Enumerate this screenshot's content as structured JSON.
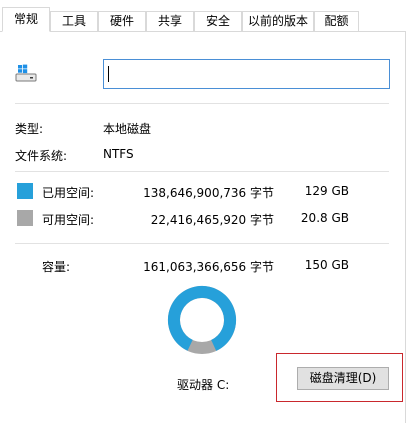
{
  "tabs": [
    {
      "label": "常规",
      "active": true
    },
    {
      "label": "工具"
    },
    {
      "label": "硬件"
    },
    {
      "label": "共享"
    },
    {
      "label": "安全"
    },
    {
      "label": "以前的版本"
    },
    {
      "label": "配额"
    }
  ],
  "drive_name_value": "",
  "type": {
    "label": "类型:",
    "value": "本地磁盘"
  },
  "filesystem": {
    "label": "文件系统:",
    "value": "NTFS"
  },
  "used": {
    "label": "已用空间:",
    "bytes": "138,646,900,736 字节",
    "size": "129 GB",
    "color": "#26a0da"
  },
  "free": {
    "label": "可用空间:",
    "bytes": "22,416,465,920 字节",
    "size": "20.8 GB",
    "color": "#a8a8a8"
  },
  "capacity": {
    "label": "容量:",
    "bytes": "161,063,366,656 字节",
    "size": "150 GB"
  },
  "usage_fraction": 0.86,
  "drive_label": "驱动器 C:",
  "cleanup_button": "磁盘清理(D)",
  "icons": [
    "drive-icon",
    "usage-donut-chart"
  ]
}
